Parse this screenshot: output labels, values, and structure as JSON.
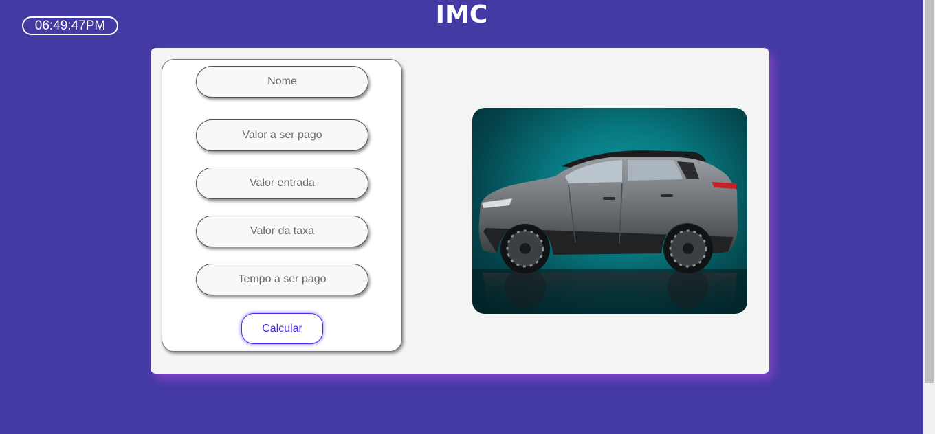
{
  "clock": {
    "time": "06:49:47PM"
  },
  "header": {
    "title": "IMC"
  },
  "form": {
    "fields": [
      {
        "placeholder": "Nome",
        "value": ""
      },
      {
        "placeholder": "Valor a ser pago",
        "value": ""
      },
      {
        "placeholder": "Valor entrada",
        "value": ""
      },
      {
        "placeholder": "Valor da taxa",
        "value": ""
      },
      {
        "placeholder": "Tempo a ser pago",
        "value": ""
      }
    ],
    "submit_label": "Calcular"
  },
  "image": {
    "subject": "car-photo"
  },
  "colors": {
    "background": "#443aa3",
    "panel": "#f4f4f4",
    "accent": "#4a2ee8",
    "panel_shadow": "#9646d2",
    "image_backdrop": "#0f9ea6"
  }
}
